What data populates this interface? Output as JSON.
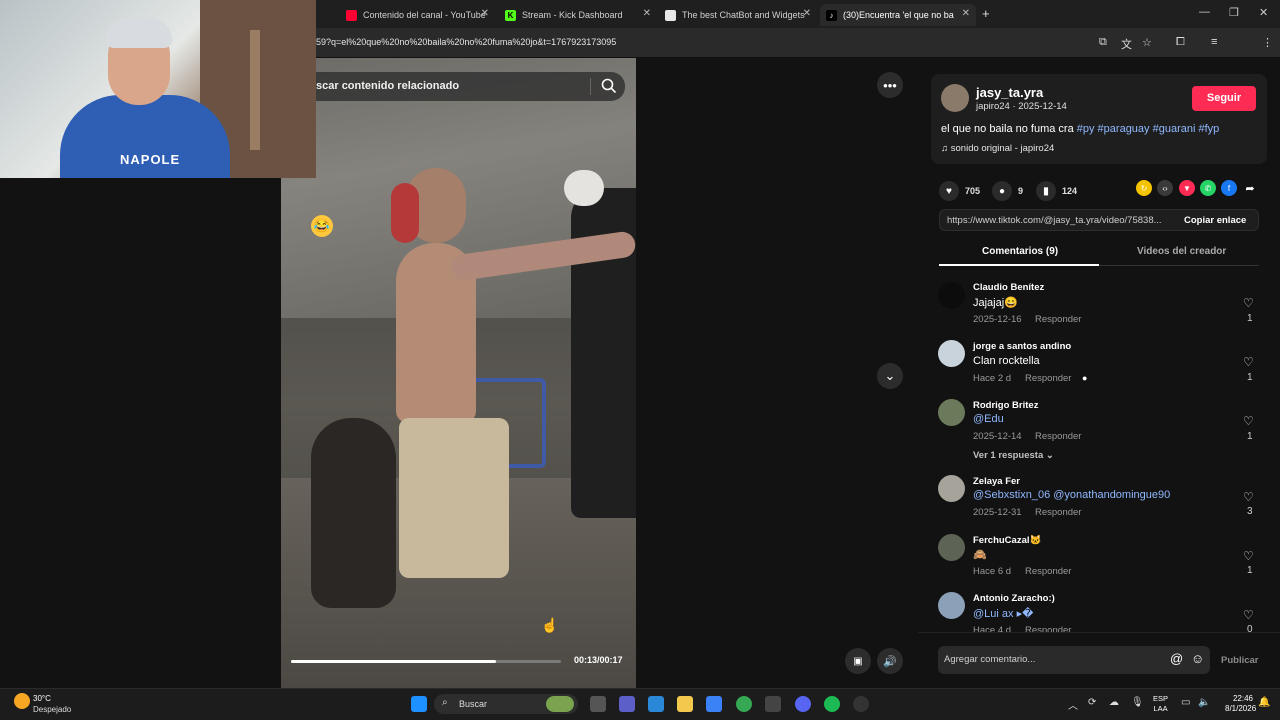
{
  "browser": {
    "tabs": [
      {
        "label": "Contenido del canal - YouTube",
        "color": "#ff0033"
      },
      {
        "label": "Stream - Kick Dashboard",
        "color": "#53fc18"
      },
      {
        "label": "The best ChatBot and Widgets",
        "color": "#e8e8e8"
      },
      {
        "label": "(30)Encuentra 'el que no ba",
        "color": "#ffffff"
      }
    ],
    "new_tab": "+",
    "url": "59?q=el%20que%20no%20baila%20no%20fuma%20jo&t=1767923173095"
  },
  "video": {
    "search_placeholder": "scar contenido relacionado",
    "time": "00:13/00:17",
    "progress_fraction": 0.76
  },
  "webcam": {
    "shirt_text": "NAPOLE"
  },
  "post": {
    "username": "jasy_ta.yra",
    "sub": "japiro24 · 2025-12-14",
    "follow": "Seguir",
    "desc_text": "el que no baila no fuma cra",
    "hashtags": "#py #paraguay #guarani #fyp",
    "music": "sonido original - japiro24",
    "likes": "705",
    "comments": "9",
    "saves": "124",
    "link": "https://www.tiktok.com/@jasy_ta.yra/video/75838...",
    "copy_link": "Copiar enlace"
  },
  "tabs": {
    "comments": "Comentarios (9)",
    "videos": "Videos del creador"
  },
  "comments": [
    {
      "name": "Claudio Benítez",
      "text": "Jajajaj😄",
      "date": "2025-12-16",
      "reply": "Responder",
      "likes": "1"
    },
    {
      "name": "jorge a santos andino",
      "text": "Clan rocktella",
      "date": "Hace 2 d",
      "reply": "Responder",
      "likes": "1"
    },
    {
      "name": "Rodrigo Britez",
      "text": "@Edu",
      "date": "2025-12-14",
      "reply": "Responder",
      "likes": "1",
      "more": "Ver 1 respuesta ⌄"
    },
    {
      "name": "Zelaya Fer",
      "text": "@Sebxstixn_06 @yonathandomingue90",
      "date": "2025-12-31",
      "reply": "Responder",
      "likes": "3"
    },
    {
      "name": "FerchuCazal🐱",
      "text": "🙈",
      "date": "Hace 6 d",
      "reply": "Responder",
      "likes": "1"
    },
    {
      "name": "Antonio Zaracho:)",
      "text": "@Lui ax ▸�",
      "date": "Hace 4 d",
      "reply": "Responder",
      "likes": "0"
    }
  ],
  "composer": {
    "placeholder": "Agregar comentario...",
    "publish": "Publicar"
  },
  "taskbar": {
    "temp": "30°C",
    "weather": "Despejado",
    "search": "Buscar",
    "lang1": "ESP",
    "lang2": "LAA",
    "time": "22:46",
    "date": "8/1/2026"
  }
}
